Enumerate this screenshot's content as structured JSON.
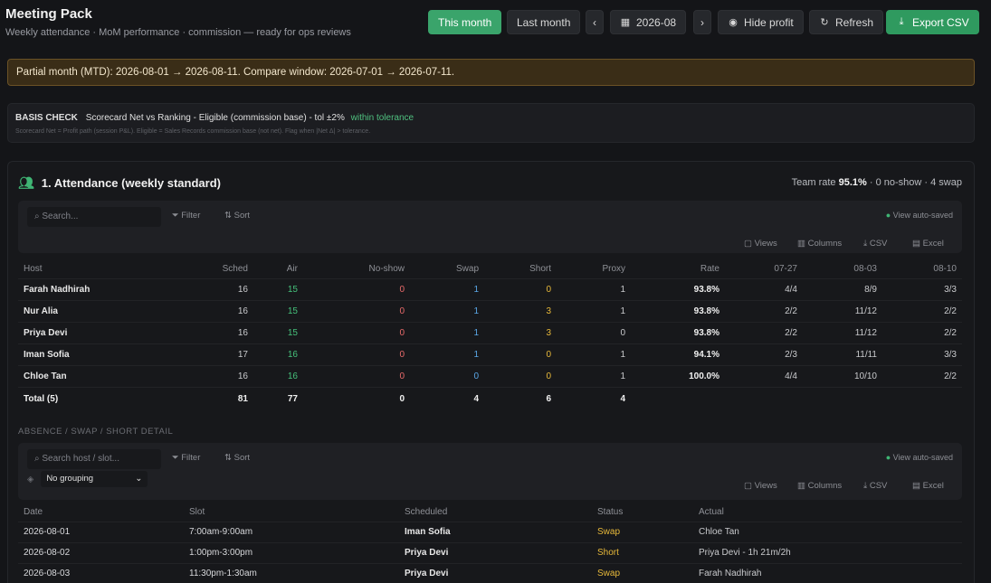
{
  "header": {
    "title": "Meeting Pack",
    "subtitle": "Weekly attendance · MoM performance · commission — ready for ops reviews",
    "this_month": "This month",
    "last_month": "Last month",
    "prev": "‹",
    "period": "2026-08",
    "next": "›",
    "hide_profit": "Hide profit",
    "refresh": "Refresh",
    "export_csv": "Export CSV"
  },
  "banner": "Partial month (MTD): 2026-08-01 → 2026-08-11. Compare window: 2026-07-01 → 2026-07-11.",
  "basis": {
    "label": "BASIS CHECK",
    "text": "Scorecard Net vs Ranking - Eligible (commission base) - tol ±2%",
    "status": "within tolerance",
    "note": "Scorecard Net = Profit path (session P&L). Eligible = Sales Records commission base (not net). Flag when |Net Δ| > tolerance."
  },
  "attendance": {
    "title": "1. Attendance (weekly standard)",
    "team_prefix": "Team rate",
    "team_rate": "95.1%",
    "team_suffix": "· 0 no-show · 4 swap",
    "toolbar": {
      "search_placeholder": "Search...",
      "filter": "Filter",
      "sort": "Sort",
      "autosave": "View auto-saved",
      "views": "Views",
      "columns": "Columns",
      "csv": "CSV",
      "excel": "Excel"
    },
    "columns": [
      "Host",
      "Sched",
      "Air",
      "No-show",
      "Swap",
      "Short",
      "Proxy",
      "Rate",
      "07-27",
      "08-03",
      "08-10"
    ],
    "rows": [
      [
        "Farah Nadhirah",
        "16",
        "15",
        "0",
        "1",
        "0",
        "1",
        "93.8%",
        "4/4",
        "8/9",
        "3/3"
      ],
      [
        "Nur Alia",
        "16",
        "15",
        "0",
        "1",
        "3",
        "1",
        "93.8%",
        "2/2",
        "11/12",
        "2/2"
      ],
      [
        "Priya Devi",
        "16",
        "15",
        "0",
        "1",
        "3",
        "0",
        "93.8%",
        "2/2",
        "11/12",
        "2/2"
      ],
      [
        "Iman Sofia",
        "17",
        "16",
        "0",
        "1",
        "0",
        "1",
        "94.1%",
        "2/3",
        "11/11",
        "3/3"
      ],
      [
        "Chloe Tan",
        "16",
        "16",
        "0",
        "0",
        "0",
        "1",
        "100.0%",
        "4/4",
        "10/10",
        "2/2"
      ]
    ],
    "total": [
      "Total (5)",
      "81",
      "77",
      "0",
      "4",
      "6",
      "4"
    ]
  },
  "detail": {
    "title": "ABSENCE / SWAP / SHORT DETAIL",
    "toolbar": {
      "search_placeholder": "Search host / slot...",
      "filter": "Filter",
      "sort": "Sort",
      "autosave": "View auto-saved",
      "grouping": "No grouping",
      "views": "Views",
      "columns": "Columns",
      "csv": "CSV",
      "excel": "Excel"
    },
    "columns": [
      "Date",
      "Slot",
      "Scheduled",
      "Status",
      "Actual"
    ],
    "rows": [
      [
        "2026-08-01",
        "7:00am-9:00am",
        "Iman Sofia",
        "Swap",
        "Chloe Tan"
      ],
      [
        "2026-08-02",
        "1:00pm-3:00pm",
        "Priya Devi",
        "Short",
        "Priya Devi - 1h 21m/2h"
      ],
      [
        "2026-08-03",
        "11:30pm-1:30am",
        "Priya Devi",
        "Swap",
        "Farah Nadhirah"
      ]
    ]
  }
}
